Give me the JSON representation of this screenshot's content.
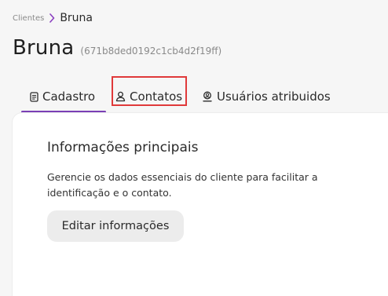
{
  "breadcrumb": {
    "root": "Clientes",
    "current": "Bruna"
  },
  "header": {
    "title": "Bruna",
    "id": "(671b8ded0192c1cb4d2f19ff)"
  },
  "tabs": [
    {
      "label": "Cadastro",
      "icon": "document-icon",
      "active": true
    },
    {
      "label": "Contatos",
      "icon": "contact-user-icon",
      "active": false,
      "highlighted": true
    },
    {
      "label": "Usuários atribuidos",
      "icon": "assigned-user-icon",
      "active": false
    }
  ],
  "card": {
    "title": "Informações principais",
    "description": "Gerencie os dados essenciais do cliente para facilitar a identificação e o contato.",
    "edit_label": "Editar informações"
  },
  "colors": {
    "accent": "#7a3fb5",
    "highlight": "#e0393a",
    "background": "#f6f6f6",
    "card": "#ffffff",
    "button": "#ececec"
  }
}
